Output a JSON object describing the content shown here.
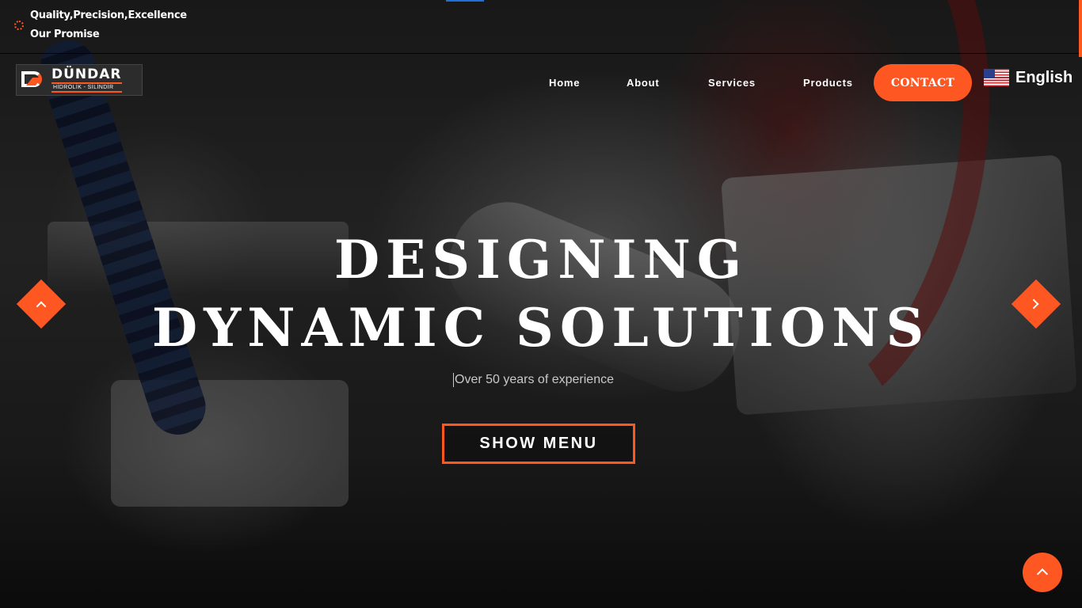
{
  "promise": {
    "line1": "Quality,Precision,Excellence",
    "line2": "Our Promise"
  },
  "logo": {
    "name": "DÜNDAR",
    "tagline": "HİDROLİK - SİLİNDİR"
  },
  "nav": {
    "items": [
      {
        "label": "Home"
      },
      {
        "label": "About"
      },
      {
        "label": "Services"
      },
      {
        "label": "Products"
      }
    ],
    "contact_label": "CONTACT"
  },
  "language": {
    "label": "English",
    "flag_icon": "us-flag-icon"
  },
  "hero": {
    "title_line1": "DESIGNING",
    "title_line2": "DYNAMIC SOLUTIONS",
    "subtitle": "Over 50 years of experience",
    "cta_label": "SHOW MENU"
  },
  "colors": {
    "accent": "#ff5722",
    "text": "#ffffff",
    "top_accent": "#1e6fd9"
  },
  "icons": {
    "prev": "chevron-left-icon",
    "next": "chevron-right-icon",
    "scroll_top": "chevron-up-icon",
    "promise": "gear-icon"
  }
}
